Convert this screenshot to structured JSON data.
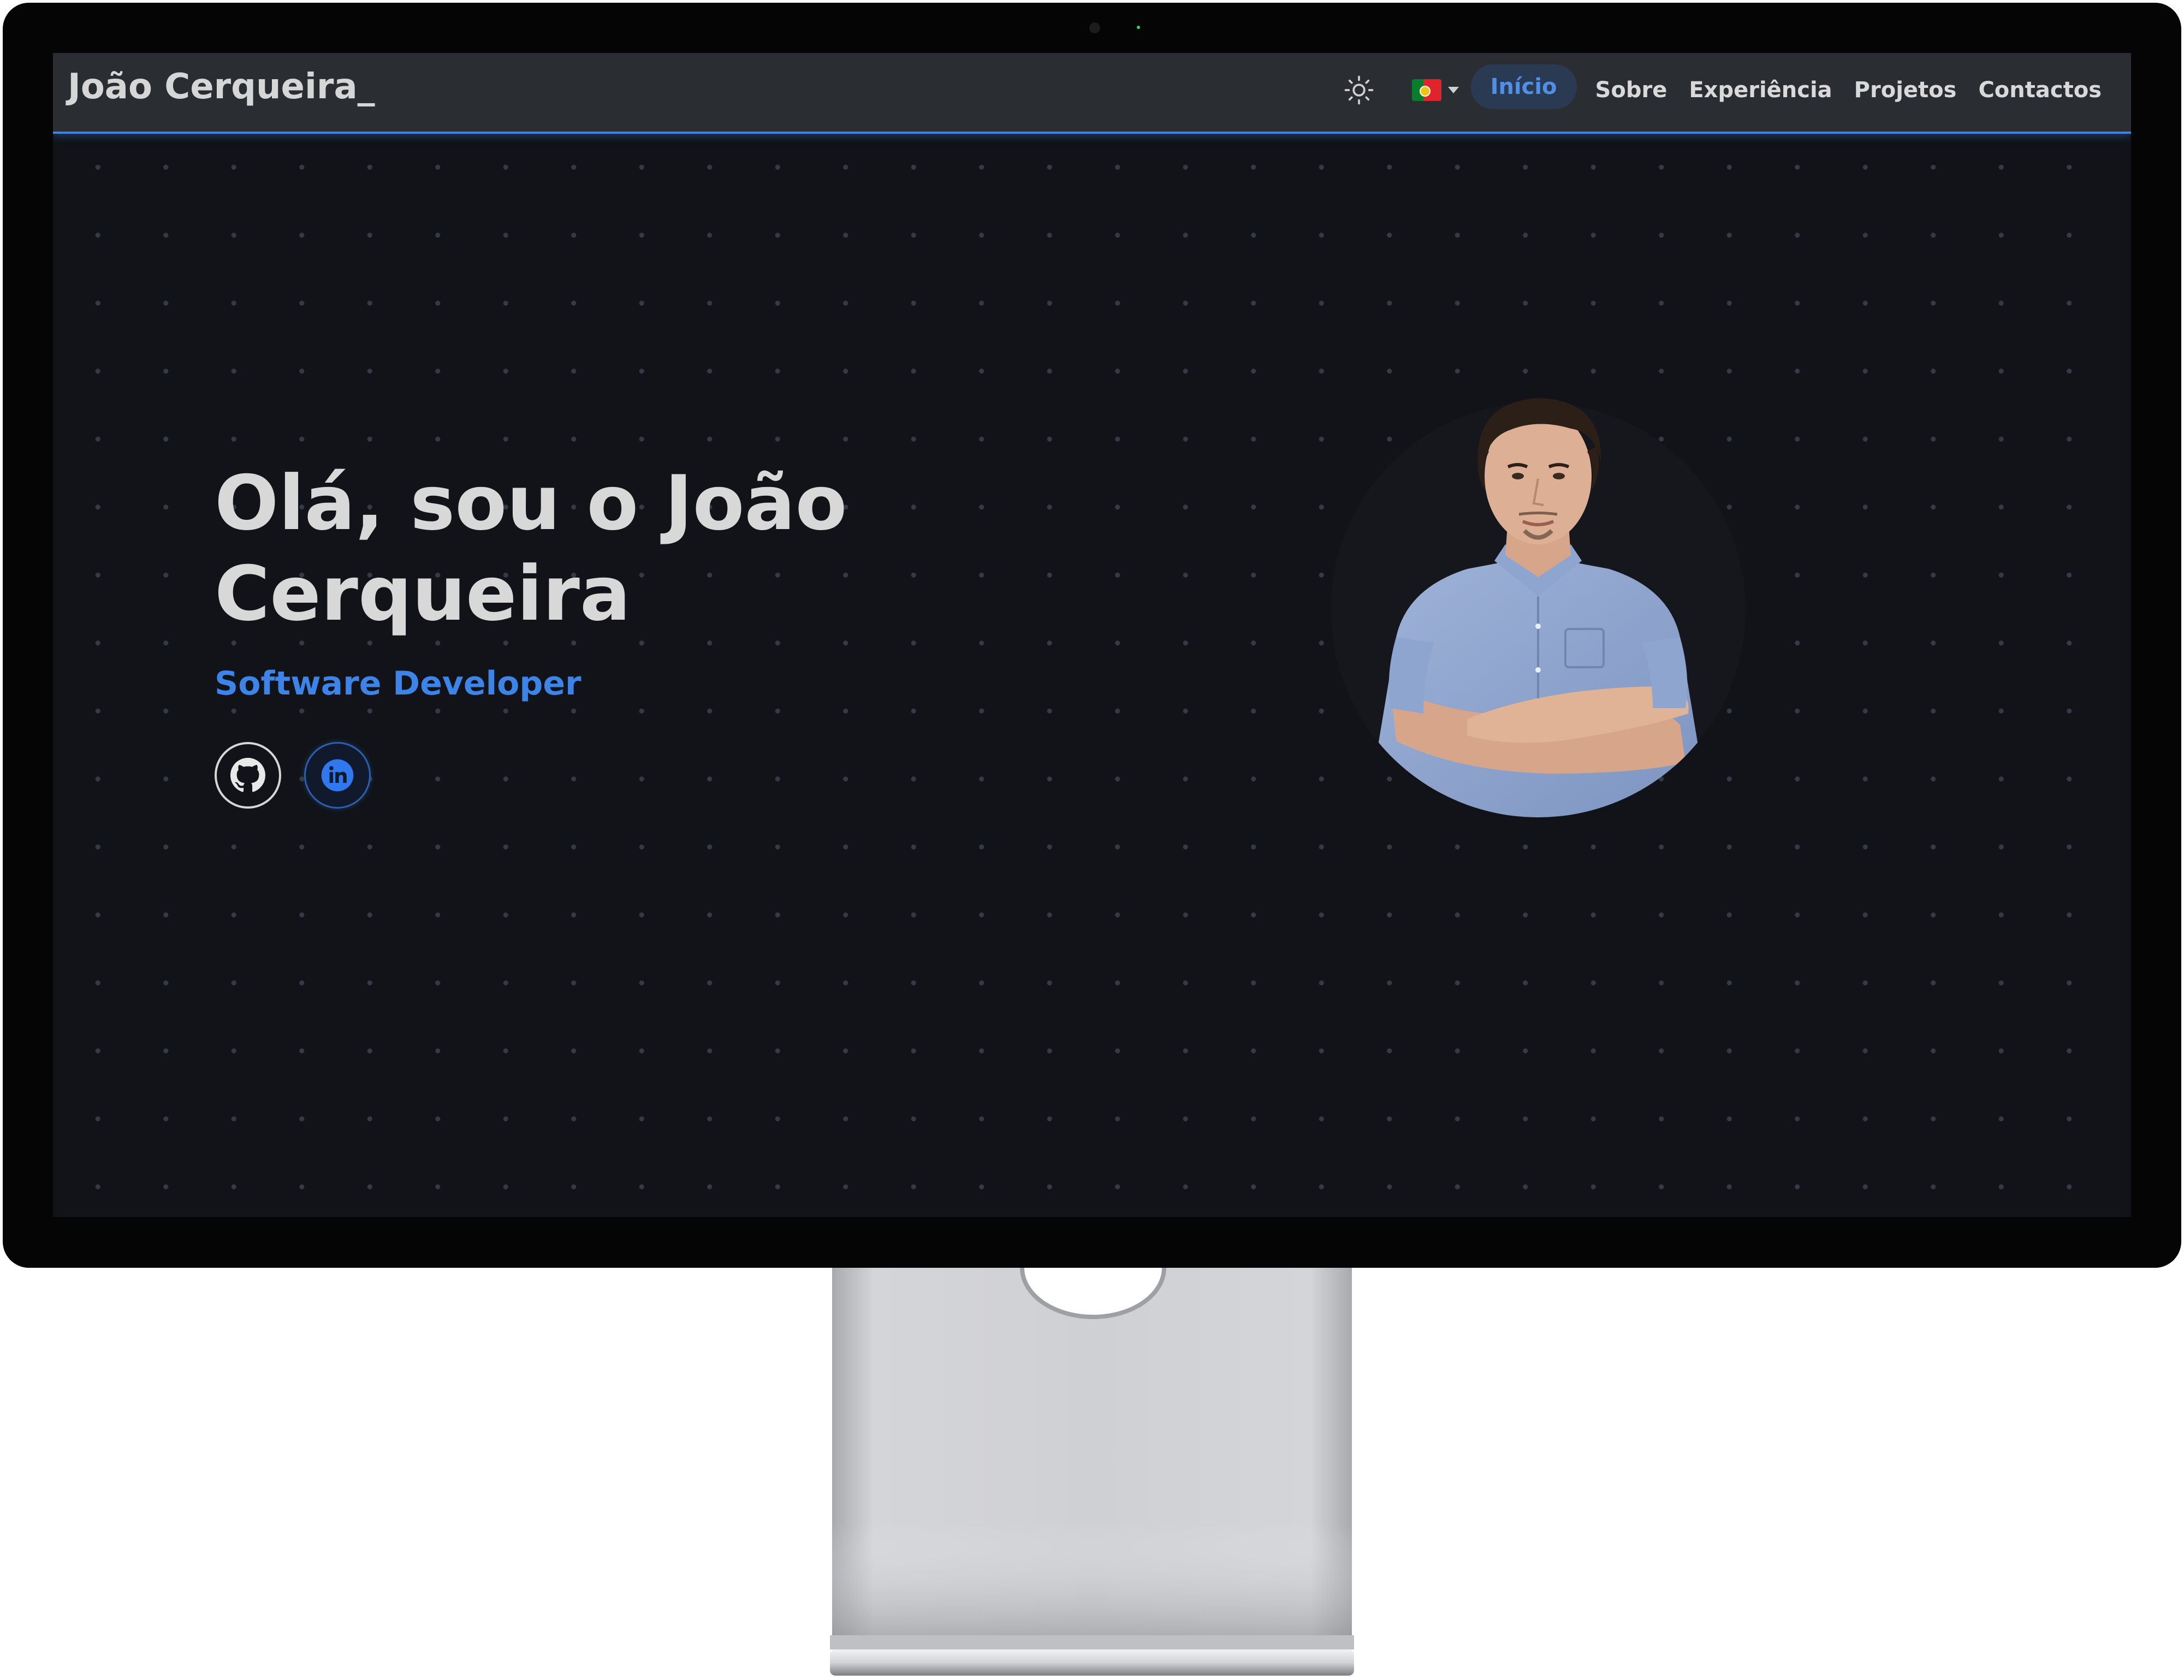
{
  "navbar": {
    "brand": "João Cerqueira_",
    "theme_toggle_icon": "sun-icon",
    "language_flag": "portugal-flag-icon",
    "links": [
      {
        "label": "Início",
        "active": true
      },
      {
        "label": "Sobre",
        "active": false
      },
      {
        "label": "Experiência",
        "active": false
      },
      {
        "label": "Projetos",
        "active": false
      },
      {
        "label": "Contactos",
        "active": false
      }
    ]
  },
  "hero": {
    "title_line1": "Olá, sou o João",
    "title_line2": "Cerqueira",
    "subtitle": "Software Developer",
    "social": [
      {
        "icon": "github-icon"
      },
      {
        "icon": "linkedin-icon"
      }
    ]
  },
  "colors": {
    "accent": "#3d84e8",
    "background": "#111318",
    "navbar": "#2a2d31",
    "text": "#d8d8d8"
  }
}
